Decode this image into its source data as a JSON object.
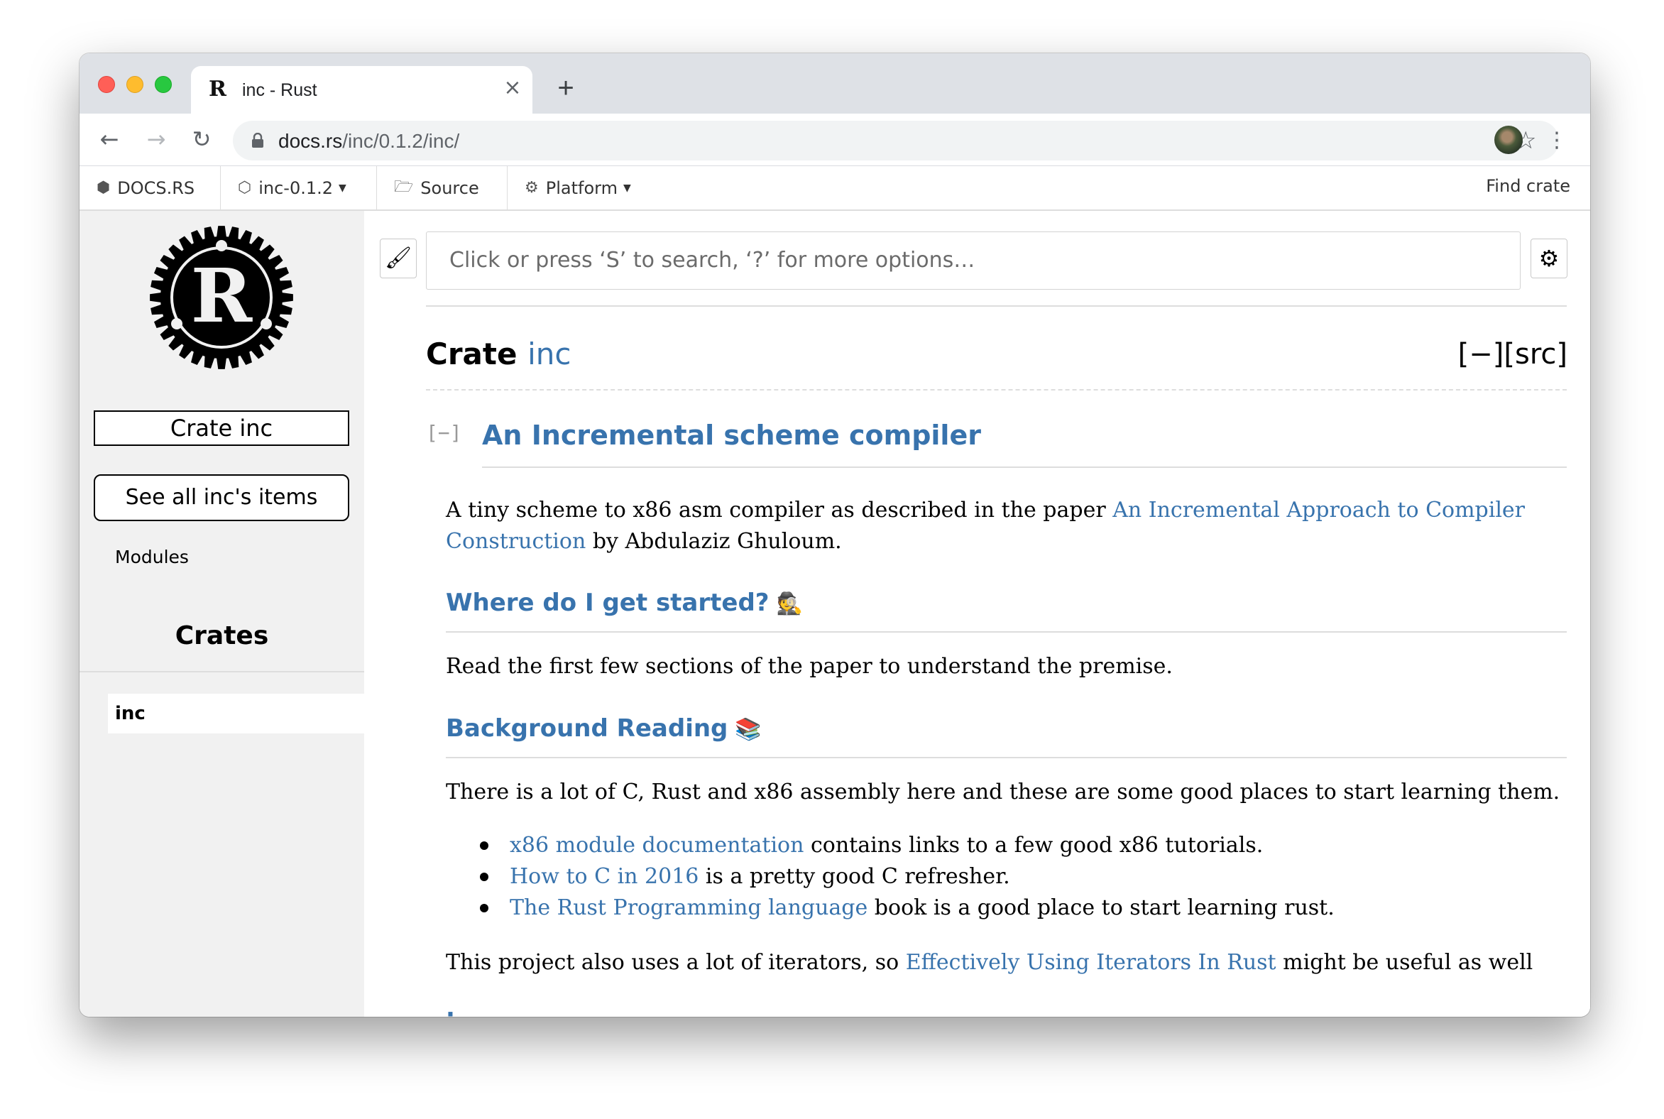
{
  "browser": {
    "tab_title": "inc - Rust",
    "tab_close": "×",
    "new_tab": "+",
    "url_host": "docs.rs",
    "url_path": "/inc/0.1.2/inc/"
  },
  "docsrs_nav": {
    "logo_label": "DOCS.RS",
    "crate_label": "inc-0.1.2",
    "source_label": "Source",
    "platform_label": "Platform",
    "find_crate_label": "Find crate"
  },
  "sidebar": {
    "crate_title": "Crate inc",
    "all_items_label": "See all inc's items",
    "modules_label": "Modules",
    "crates_heading": "Crates",
    "crate_item": "inc"
  },
  "main": {
    "search_placeholder": "Click or press ‘S’ to search, ‘?’ for more options…",
    "fqn_prefix": "Crate",
    "fqn_name": "inc",
    "fqn_controls": "[−][src]",
    "toggle_label": "[−]",
    "heading": "An Incremental scheme compiler",
    "intro_before": "A tiny scheme to x86 asm compiler as described in the paper ",
    "intro_link": "An Incremental Approach to Compiler Construction",
    "intro_after": " by Abdulaziz Ghuloum.",
    "section1_heading": "Where do I get started?",
    "section1_emoji": "🕵",
    "section1_text": "Read the first few sections of the paper to understand the premise.",
    "section2_heading": "Background Reading",
    "section2_emoji": "📚",
    "section2_text": "There is a lot of C, Rust and x86 assembly here and these are some good places to start learning them.",
    "list": [
      {
        "link": "x86 module documentation",
        "text": " contains links to a few good x86 tutorials."
      },
      {
        "link": "How to C in 2016",
        "text": " is a pretty good C refresher."
      },
      {
        "link": "The Rust Programming language",
        "text": " book is a good place to start learning rust."
      }
    ],
    "closing_before": "This project also uses a lot of iterators, so ",
    "closing_link": "Effectively Using Iterators In Rust",
    "closing_after": " might be useful as well"
  },
  "colors": {
    "link": "#3873ad",
    "sidebar_bg": "#f1f1f1",
    "tabstrip_bg": "#dee1e6"
  }
}
